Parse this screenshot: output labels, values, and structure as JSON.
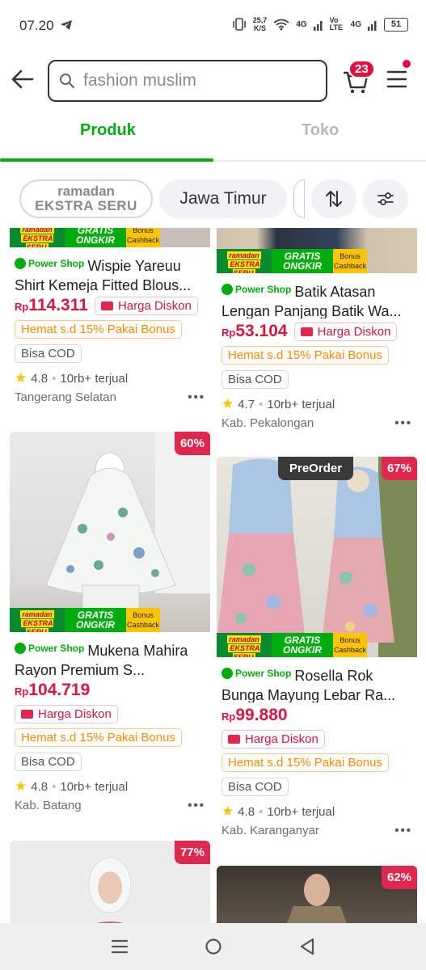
{
  "status": {
    "time": "07.20",
    "speed": "25,7",
    "speed_unit": "K/S",
    "net1": "4G",
    "net2": "Vo LTE",
    "net3": "4G",
    "battery": "51"
  },
  "search": {
    "placeholder": "fashion muslim"
  },
  "cart": {
    "count": "23"
  },
  "tabs": [
    {
      "label": "Produk"
    },
    {
      "label": "Toko"
    }
  ],
  "filters": {
    "ramadan_line1": "ramadan",
    "ramadan_line2": "EKSTRA SERU",
    "location": "Jawa Timur"
  },
  "promo": {
    "ramadan": "ramadan",
    "ekstra": "EKSTRA SERU",
    "gratis": "GRATIS",
    "ongkir": "ONGKIR",
    "bonus": "Bonus",
    "cashback": "Cashback"
  },
  "products": [
    {
      "badge": "Power Shop",
      "title": "Wispie Yareuu Shirt Kemeja Fitted Blous...",
      "price_prefix": "Rp",
      "price": "114.311",
      "harga": "Harga Diskon",
      "hemat": "Hemat s.d  15% Pakai Bonus",
      "cod": "Bisa COD",
      "rating": "4.8",
      "sold": "10rb+ terjual",
      "location": "Tangerang Selatan"
    },
    {
      "badge": "Power Shop",
      "title": "Batik Atasan Lengan Panjang Batik Wa...",
      "price_prefix": "Rp",
      "price": "53.104",
      "harga": "Harga Diskon",
      "hemat": "Hemat s.d  15% Pakai Bonus",
      "cod": "Bisa COD",
      "rating": "4.7",
      "sold": "10rb+ terjual",
      "location": "Kab. Pekalongan"
    },
    {
      "discount": "60%",
      "badge": "Power Shop",
      "title": "Mukena Mahira Rayon Premium S...",
      "price_prefix": "Rp",
      "price": "104.719",
      "harga": "Harga Diskon",
      "hemat": "Hemat s.d  15% Pakai Bonus",
      "cod": "Bisa COD",
      "rating": "4.8",
      "sold": "10rb+ terjual",
      "location": "Kab. Batang"
    },
    {
      "discount": "67%",
      "preorder": "PreOrder",
      "badge": "Power Shop",
      "title": "Rosella Rok Bunga Mayung Lebar Ra...",
      "price_prefix": "Rp",
      "price": "99.880",
      "harga": "Harga Diskon",
      "hemat": "Hemat s.d  15% Pakai Bonus",
      "cod": "Bisa COD",
      "rating": "4.8",
      "sold": "10rb+ terjual",
      "location": "Kab. Karanganyar"
    },
    {
      "discount": "77%"
    },
    {
      "discount": "62%"
    }
  ]
}
